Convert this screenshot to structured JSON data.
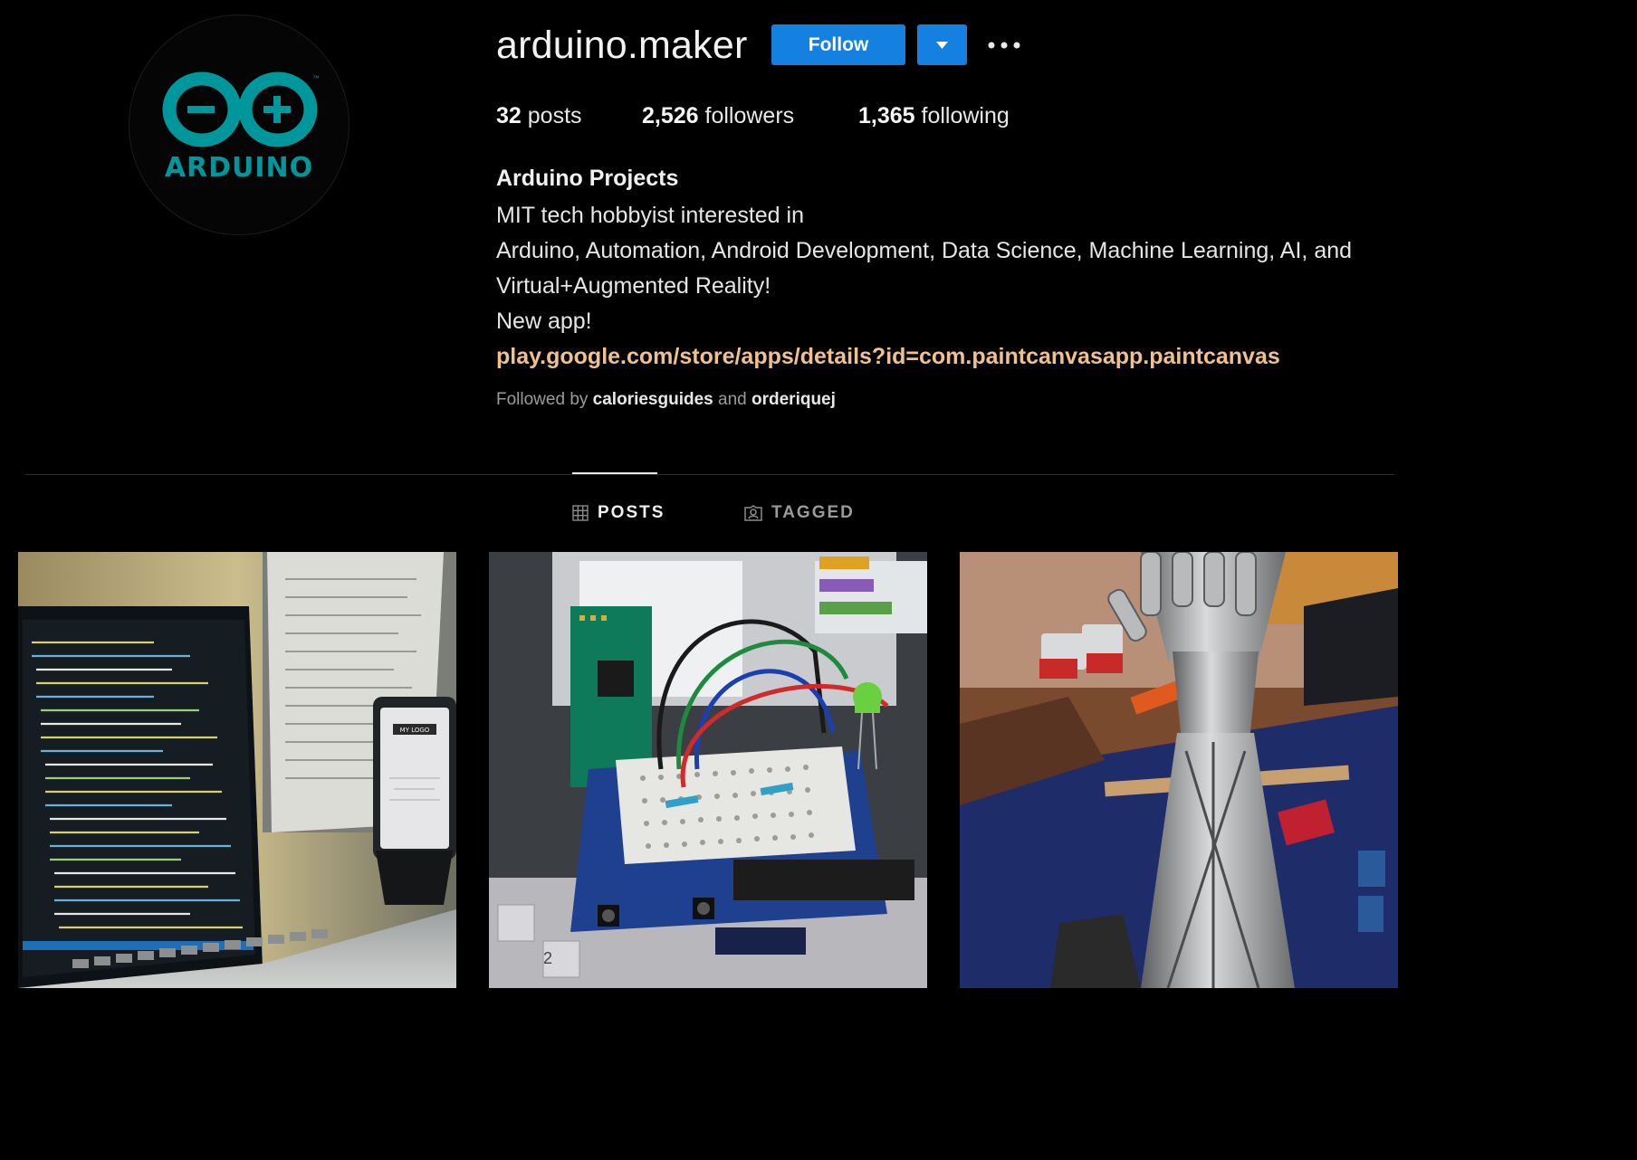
{
  "profile": {
    "username": "arduino.maker",
    "avatar_icon": "arduino-logo",
    "avatar_text": "ARDUINO",
    "follow_label": "Follow",
    "accent_color": "#1480e0"
  },
  "stats": {
    "posts_count": "32",
    "posts_label": "posts",
    "followers_count": "2,526",
    "followers_label": "followers",
    "following_count": "1,365",
    "following_label": "following"
  },
  "bio": {
    "name": "Arduino Projects",
    "lines": [
      "MIT tech hobbyist interested in",
      "Arduino, Automation, Android Development, Data Science, Machine Learning, AI, and",
      "Virtual+Augmented Reality!",
      "New app!"
    ],
    "link": "play.google.com/store/apps/details?id=com.paintcanvasapp.paintcanvas",
    "link_color": "#f0c08e"
  },
  "followed_by": {
    "prefix": "Followed by",
    "user1": "caloriesguides",
    "joiner": "and",
    "user2": "orderiquej"
  },
  "tabs": [
    {
      "label": "POSTS",
      "icon": "grid-icon",
      "active": true
    },
    {
      "label": "TAGGED",
      "icon": "tagged-icon",
      "active": false
    }
  ],
  "posts": [
    {
      "subject": "laptop-code-editor-and-phone",
      "phone_screen_text": "MY LOGO"
    },
    {
      "subject": "arduino-breadboard-circuit"
    },
    {
      "subject": "robotic-arm-on-workbench"
    }
  ]
}
